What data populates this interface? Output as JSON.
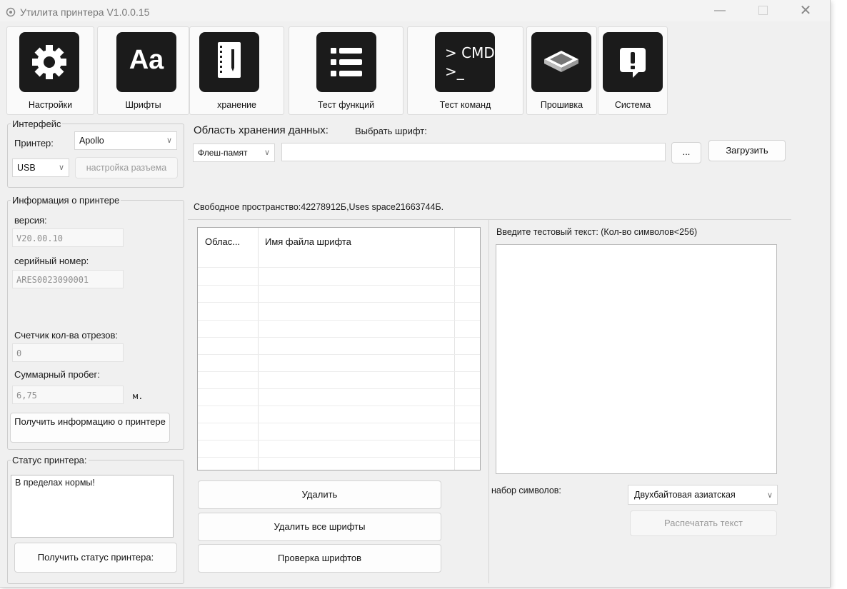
{
  "window": {
    "title": "Утилита принтера  V1.0.0.15",
    "controls": {
      "minimize": "—",
      "close": "✕"
    }
  },
  "toolbar": [
    {
      "label": "Настройки",
      "icon": "gear-icon"
    },
    {
      "label": "Шрифты",
      "icon": "font-aa-icon",
      "glyph": "Aa"
    },
    {
      "label": "хранение",
      "icon": "notebook-pencil-icon"
    },
    {
      "label": "Тест функций",
      "icon": "list-icon"
    },
    {
      "label": "Тест команд",
      "icon": "cmd-terminal-icon",
      "glyph": "> CMD\n>_"
    },
    {
      "label": "Прошивка",
      "icon": "chip-icon"
    },
    {
      "label": "Система",
      "icon": "alert-bubble-icon"
    }
  ],
  "interface": {
    "legend": "Интерфейс",
    "printer_label": "Принтер:",
    "printer_value": "Apollo",
    "port_value": "USB",
    "port_settings_button": "настройка разъема"
  },
  "printer_info": {
    "legend": "Информация о принтере",
    "version_label": "версия:",
    "version_value": "V20.00.10",
    "serial_label": "серийный номер:",
    "serial_value": "ARES0023090001",
    "cut_counter_label": "Счетчик кол-ва отрезов:",
    "cut_counter_value": "0",
    "mileage_label": "Суммарный пробег:",
    "mileage_value": "6,75",
    "mileage_unit": "м.",
    "get_info_button": "Получить информацию о принтере"
  },
  "printer_status": {
    "legend": "Статус принтера:",
    "status_text": "В пределах нормы!",
    "get_status_button": "Получить статус принтера:"
  },
  "storage": {
    "area_label": "Область хранения данных:",
    "select_font_label": "Выбрать шрифт:",
    "area_value": "Флеш-памят",
    "file_path_value": "",
    "browse_button": "...",
    "load_button": "Загрузить",
    "space_info": "Свободное пространство:42278912Б,Uses space21663744Б."
  },
  "font_table": {
    "columns": [
      "Облас...",
      "Имя файла шрифта",
      ""
    ],
    "rows": []
  },
  "font_actions": {
    "delete_button": "Удалить",
    "delete_all_button": "Удалить все шрифты",
    "check_fonts_button": "Проверка шрифтов"
  },
  "test_text": {
    "label": "Введите тестовый текст: (Кол-во символов<256)",
    "value": "",
    "charset_label": "набор символов:",
    "charset_value": "Двухбайтовая азиатская",
    "print_button": "Распечатать текст"
  }
}
